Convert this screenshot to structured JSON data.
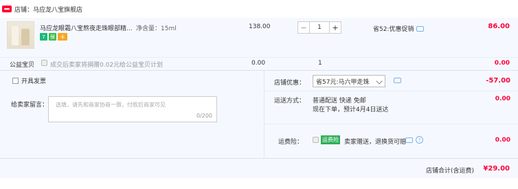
{
  "store": {
    "label": "店铺：",
    "name": "马应龙八宝旗舰店",
    "badge_icon": "tmall-icon",
    "badge_color": "#ff0036"
  },
  "item": {
    "title": "马应龙眼霜八宝熬夜走珠眼部精...",
    "spec": "净含量：15ml",
    "badges": [
      "7",
      "保",
      "卡"
    ],
    "unit_price": "138.00",
    "quantity": "1",
    "minus_label": "−",
    "plus_label": "+",
    "saving": "省52:优惠促销",
    "total": "86.00"
  },
  "charity": {
    "label": "公益宝贝",
    "text": "成交后卖家将捐赠0.02元给公益宝贝计划",
    "unit_price": "0.00",
    "quantity": "1",
    "total": "0.00"
  },
  "invoice": {
    "label": "开具发票"
  },
  "message": {
    "label": "给卖家留言：",
    "placeholder": "选填，请先和商家协商一致，付款后商家可见",
    "counter": "0/200"
  },
  "discount": {
    "label": "店铺优惠：",
    "selected": "省57元:马六甲走珠",
    "amount": "-57.00"
  },
  "shipping": {
    "label": "运送方式：",
    "line1": "普通配送 快递 免邮",
    "line2": "现在下单，预计4月4日送达",
    "amount": "0.00"
  },
  "insurance": {
    "label": "运费险：",
    "tag": "运费险",
    "text": "卖家赠送，退换货可赔",
    "amount": "0.00"
  },
  "summary": {
    "label": "店铺合计(含运费)",
    "amount": "¥29.00"
  },
  "colors": {
    "accent_red": "#ff0036",
    "panel_bg": "#f5f9ff",
    "link_blue": "#7fb0e6"
  }
}
